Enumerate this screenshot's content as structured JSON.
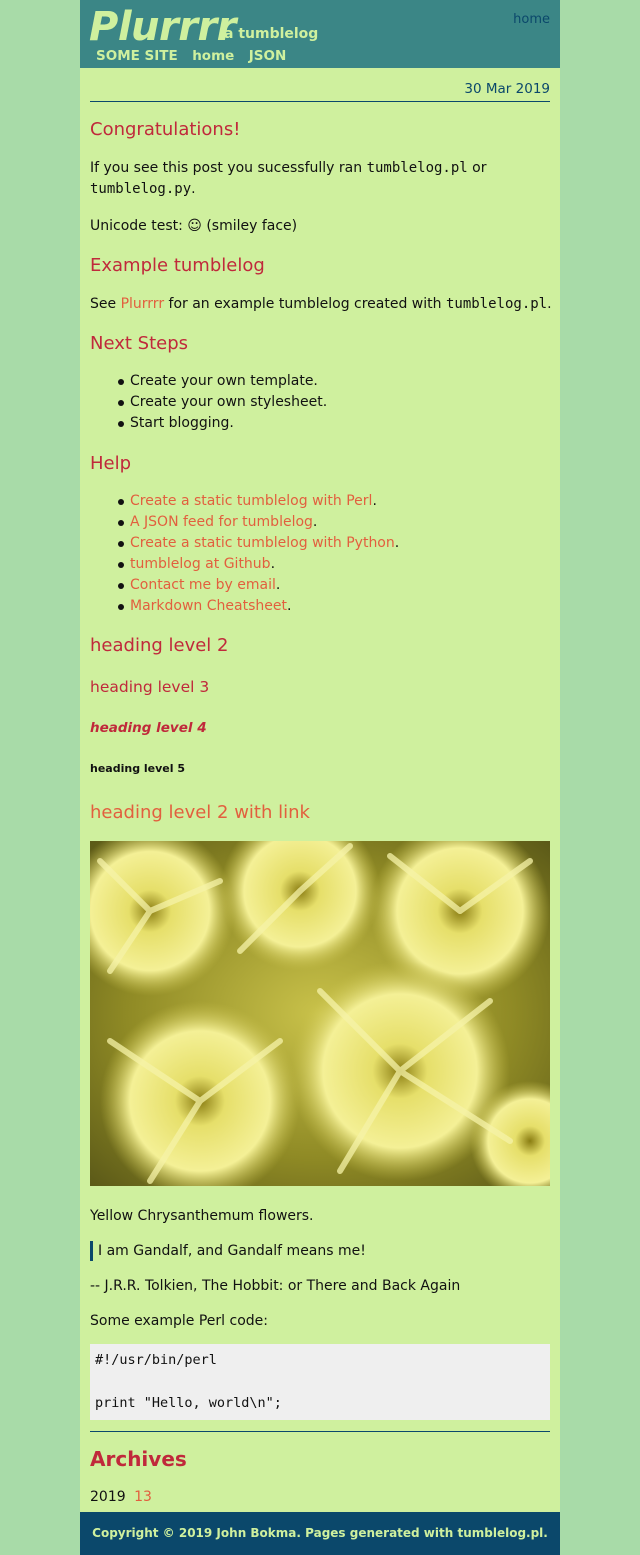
{
  "site": {
    "title": "Plurrrr",
    "tagline": "a tumblelog",
    "home_top": "home"
  },
  "nav": [
    "SOME SITE",
    "home",
    "JSON"
  ],
  "post": {
    "date": "30 Mar 2019",
    "heading1": "Congratulations!",
    "p1_a": "If you see this post you sucessfully ran",
    "p1_code1": "tumblelog.pl",
    "p1_or": "or",
    "p1_code2": "tumblelog.py",
    "p1_end": ".",
    "unicode": "Unicode test: ☺ (smiley face)",
    "heading2": "Example tumblelog",
    "p2_see": "See",
    "p2_link": "Plurrrr",
    "p2_mid": "for an example tumblelog created with",
    "p2_code": "tumblelog.pl",
    "p2_end": ".",
    "heading3": "Next Steps",
    "steps": [
      "Create your own template.",
      "Create your own stylesheet.",
      "Start blogging."
    ],
    "heading4": "Help",
    "help": [
      "Create a static tumblelog with Perl",
      "A JSON feed for tumblelog",
      "Create a static tumblelog with Python",
      "tumblelog at Github",
      "Contact me by email",
      "Markdown Cheatsheet"
    ],
    "h2": "heading level 2",
    "h3": "heading level 3",
    "h4": "heading level 4",
    "h5": "heading level 5",
    "h2_link": "heading level 2 with link",
    "image_caption": "Yellow Chrysanthemum flowers.",
    "quote": "I am Gandalf, and Gandalf means me!",
    "attribution": "-- J.R.R. Tolkien, The Hobbit: or There and Back Again",
    "code_intro": "Some example Perl code:",
    "code_line1": "#!/usr/bin/perl",
    "code_line2": "print \"Hello, world\\n\";"
  },
  "archives": {
    "heading": "Archives",
    "year": "2019",
    "count": "13"
  },
  "footer": "Copyright © 2019 John Bokma. Pages generated with tumblelog.pl.",
  "colors": {
    "header_bg": "#3b8686",
    "page_bg": "#cff09e",
    "outer_bg": "#a8dba8",
    "heading": "#c0293b",
    "link": "#e25f3e",
    "footer_bg": "#0b486b"
  }
}
